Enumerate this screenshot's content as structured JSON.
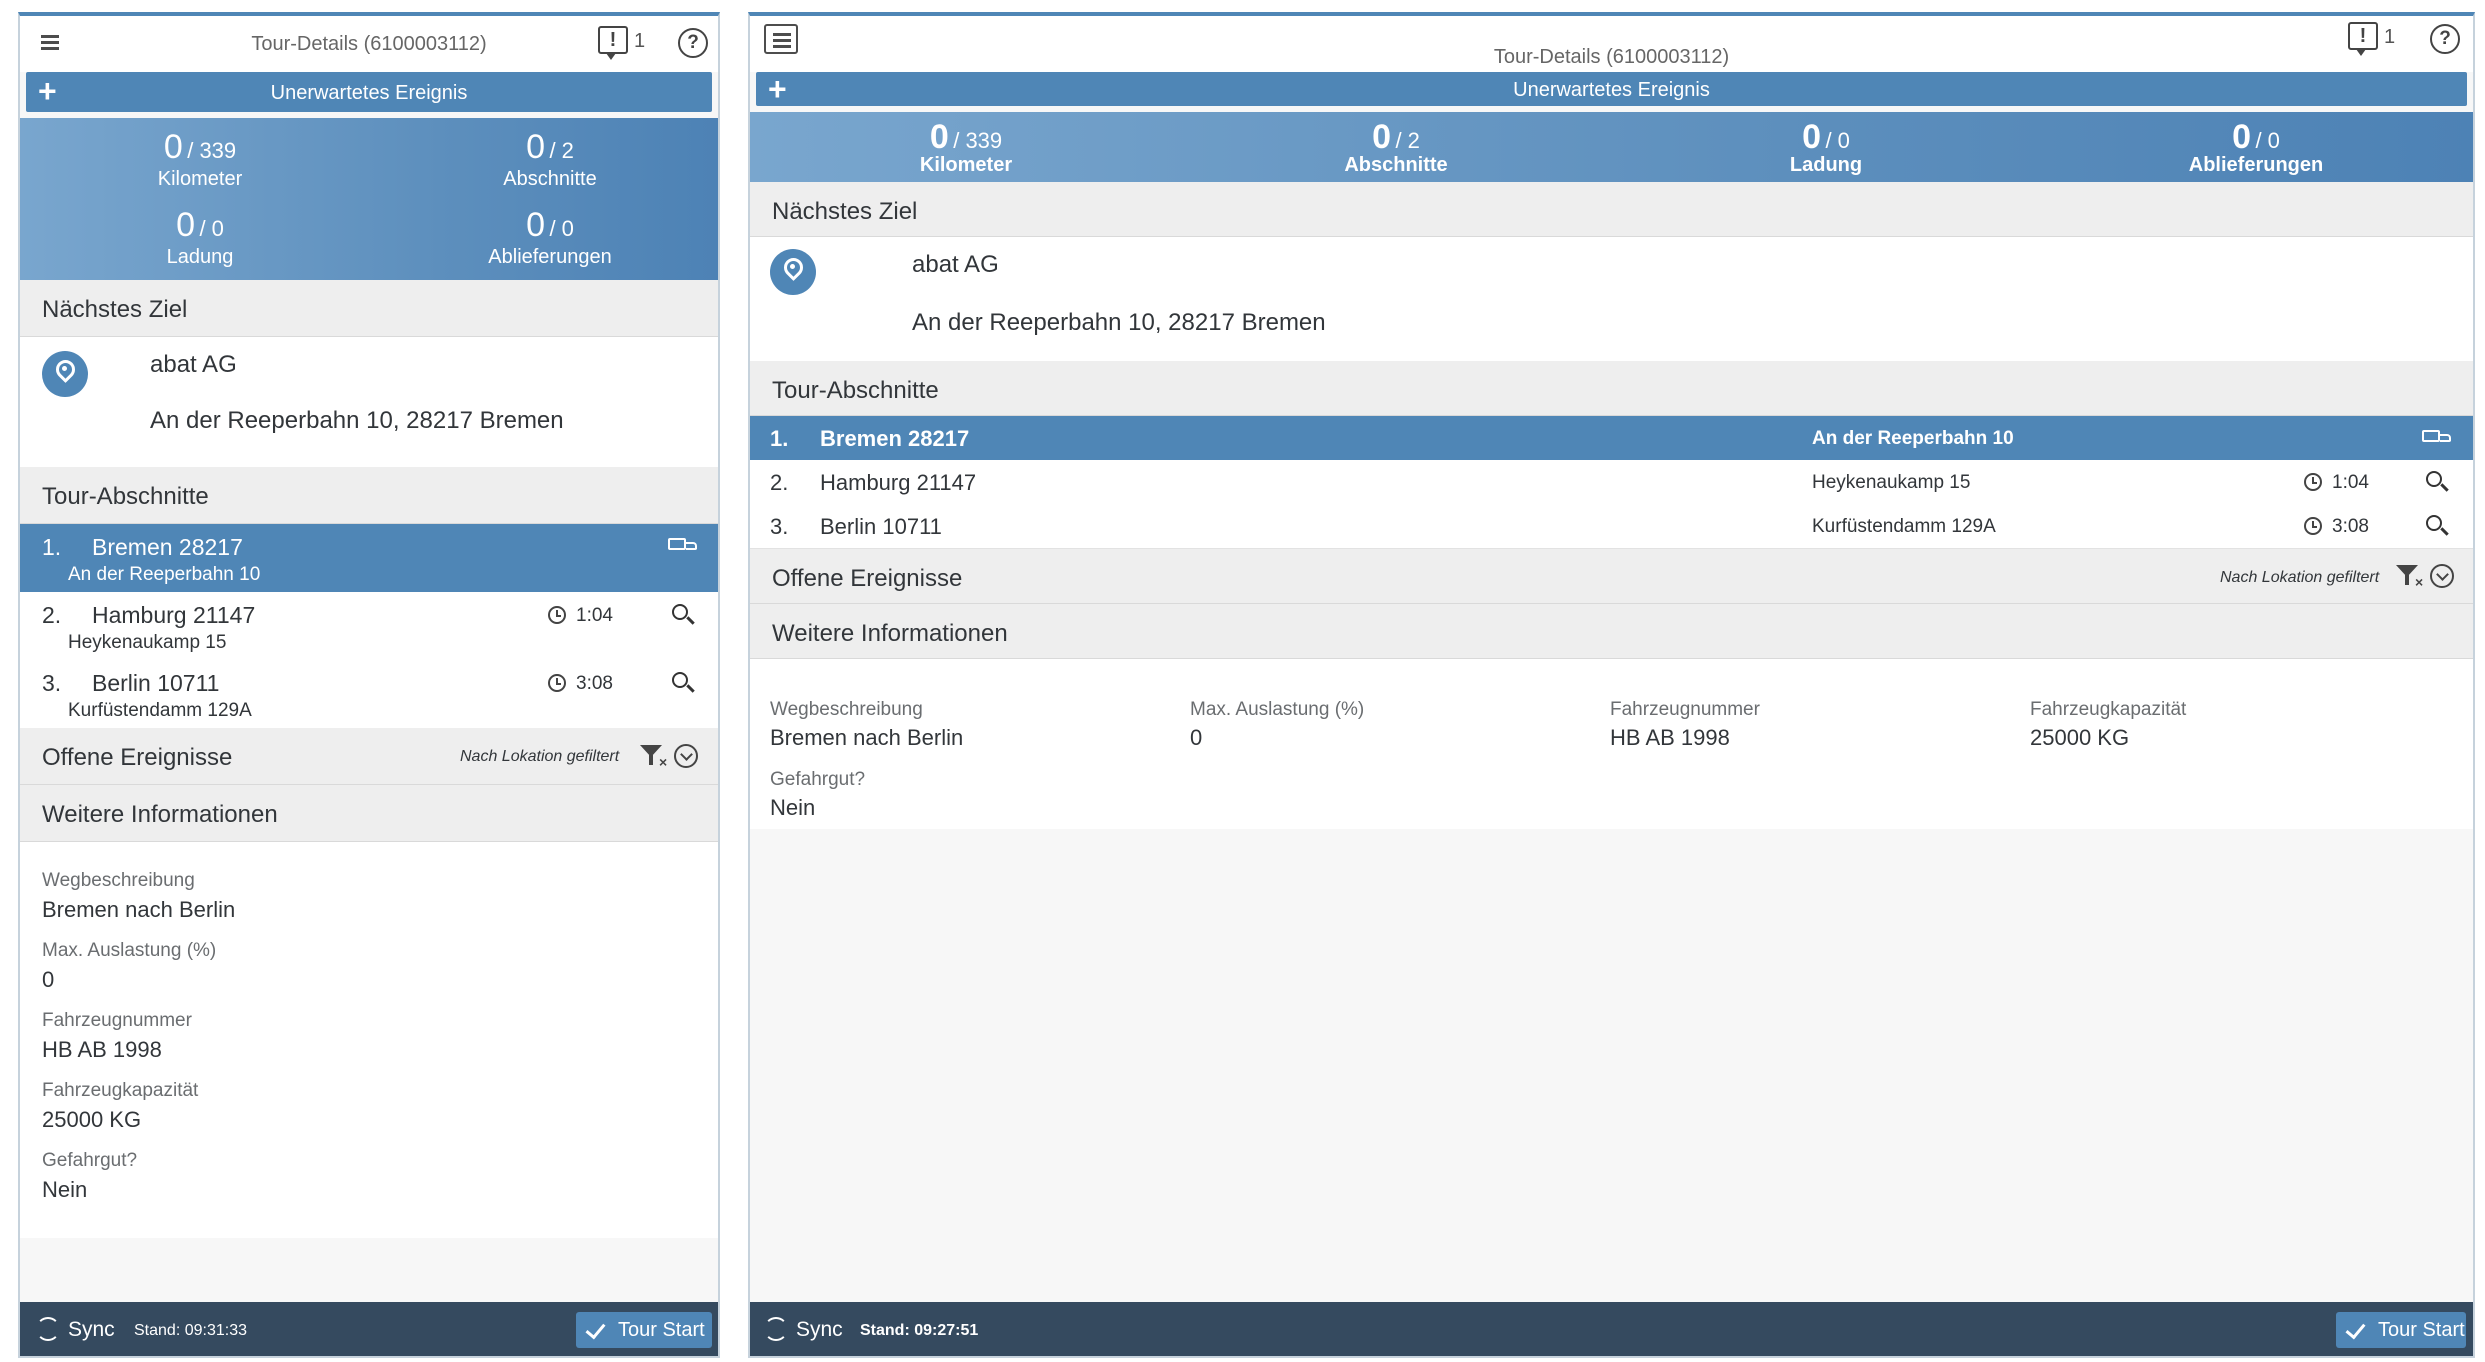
{
  "header": {
    "title": "Tour-Details (6100003112)",
    "notification_count": "1",
    "help_symbol": "?",
    "notif_symbol": "!"
  },
  "event_button": {
    "label": "Unerwartetes Ereignis",
    "plus": "+"
  },
  "stats": [
    {
      "value": "0",
      "total": "/ 339",
      "label": "Kilometer"
    },
    {
      "value": "0",
      "total": "/ 2",
      "label": "Abschnitte"
    },
    {
      "value": "0",
      "total": "/ 0",
      "label": "Ladung"
    },
    {
      "value": "0",
      "total": "/ 0",
      "label": "Ablieferungen"
    }
  ],
  "next_target": {
    "heading": "Nächstes Ziel",
    "name": "abat AG",
    "address": "An der Reeperbahn 10, 28217 Bremen"
  },
  "sections": {
    "heading": "Tour-Abschnitte",
    "items": [
      {
        "num": "1.",
        "city": "Bremen 28217",
        "street": "An der Reeperbahn 10",
        "time": ""
      },
      {
        "num": "2.",
        "city": "Hamburg 21147",
        "street": "Heykenaukamp 15",
        "time": "1:04"
      },
      {
        "num": "3.",
        "city": "Berlin 10711",
        "street": "Kurfüstendamm 129A",
        "time": "3:08"
      }
    ]
  },
  "open_events": {
    "heading": "Offene Ereignisse",
    "filter_note": "Nach Lokation gefiltert"
  },
  "more_info": {
    "heading": "Weitere Informationen",
    "fields": [
      {
        "label": "Wegbeschreibung",
        "value": "Bremen nach Berlin"
      },
      {
        "label": "Max. Auslastung (%)",
        "value": "0"
      },
      {
        "label": "Fahrzeugnummer",
        "value": "HB AB 1998"
      },
      {
        "label": "Fahrzeugkapazität",
        "value": "25000 KG"
      },
      {
        "label": "Gefahrgut?",
        "value": "Nein"
      }
    ]
  },
  "footer_left": {
    "sync_label": "Sync",
    "stand": "Stand: 09:31:33",
    "tour_start": "Tour Start"
  },
  "footer_right": {
    "sync_label": "Sync",
    "stand": "Stand: 09:27:51",
    "tour_start": "Tour Start"
  },
  "colors": {
    "accent": "#4f86b6",
    "footer": "#354a5f",
    "section_bg": "#eeeeee"
  }
}
